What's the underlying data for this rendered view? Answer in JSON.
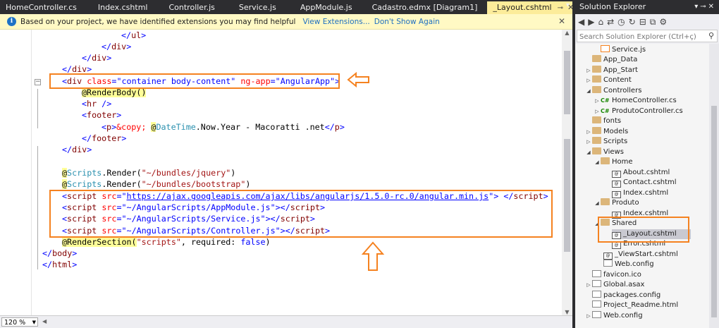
{
  "tabs": [
    {
      "label": "HomeController.cs",
      "active": false
    },
    {
      "label": "Index.cshtml",
      "active": false
    },
    {
      "label": "Controller.js",
      "active": false
    },
    {
      "label": "Service.js",
      "active": false
    },
    {
      "label": "AppModule.js",
      "active": false
    },
    {
      "label": "Cadastro.edmx [Diagram1]",
      "active": false
    },
    {
      "label": "_Layout.cshtml",
      "active": true
    }
  ],
  "infobar": {
    "message": "Based on your project, we have identified extensions you may find helpful",
    "view_extensions": "View Extensions...",
    "dont_show": "Don't Show Again"
  },
  "code": {
    "l1": "</ul>",
    "l2": "</div>",
    "l3": "</div>",
    "l4": "</div>",
    "l5_tag": "div",
    "l5_a1": "class",
    "l5_v1": "\"container body-content\"",
    "l5_a2": "ng-app",
    "l5_v2": "\"AngularApp\"",
    "l6": "@RenderBody()",
    "l7_tag": "hr",
    "l8_tag": "footer",
    "l9_ent": "&copy;",
    "l9_dt": "DateTime",
    "l9_rest": ".Now.Year - Macoratti .net",
    "l10": "</footer>",
    "l11": "</div>",
    "scripts_kw": "Scripts",
    "render": ".Render(",
    "bundle1": "\"~/bundles/jquery\"",
    "bundle2": "\"~/bundles/bootstrap\"",
    "src_attr": "src",
    "script_tag": "script",
    "src1": "https://ajax.googleapis.com/ajax/libs/angularjs/1.5.0-rc.0/angular.min.js",
    "src2": "\"~/AngularScripts/AppModule.js\"",
    "src3": "\"~/AngularScripts/Service.js\"",
    "src4": "\"~/AngularScripts/Controller.js\"",
    "render_section": "@RenderSection(",
    "scripts_str": "\"scripts\"",
    "required": ", required: ",
    "false_kw": "false",
    "body_close": "body",
    "html_close": "html"
  },
  "status": {
    "zoom": "120 %"
  },
  "solution_explorer": {
    "title": "Solution Explorer",
    "search_placeholder": "Search Solution Explorer (Ctrl+ç)",
    "items": [
      {
        "label": "Service.js",
        "kind": "js"
      },
      {
        "label": "App_Data",
        "kind": "folder"
      },
      {
        "label": "App_Start",
        "kind": "folder"
      },
      {
        "label": "Content",
        "kind": "folder"
      },
      {
        "label": "Controllers",
        "kind": "folder"
      },
      {
        "label": "HomeController.cs",
        "kind": "cs"
      },
      {
        "label": "ProdutoController.cs",
        "kind": "cs"
      },
      {
        "label": "fonts",
        "kind": "folder"
      },
      {
        "label": "Models",
        "kind": "folder"
      },
      {
        "label": "Scripts",
        "kind": "folder"
      },
      {
        "label": "Views",
        "kind": "folder"
      },
      {
        "label": "Home",
        "kind": "folder"
      },
      {
        "label": "About.cshtml",
        "kind": "cshtml"
      },
      {
        "label": "Contact.cshtml",
        "kind": "cshtml"
      },
      {
        "label": "Index.cshtml",
        "kind": "cshtml"
      },
      {
        "label": "Produto",
        "kind": "folder"
      },
      {
        "label": "Index.cshtml",
        "kind": "cshtml"
      },
      {
        "label": "Shared",
        "kind": "folder"
      },
      {
        "label": "_Layout.cshtml",
        "kind": "cshtml"
      },
      {
        "label": "Error.cshtml",
        "kind": "cshtml"
      },
      {
        "label": "_ViewStart.cshtml",
        "kind": "cshtml"
      },
      {
        "label": "Web.config",
        "kind": "config"
      },
      {
        "label": "favicon.ico",
        "kind": "file"
      },
      {
        "label": "Global.asax",
        "kind": "file"
      },
      {
        "label": "packages.config",
        "kind": "config"
      },
      {
        "label": "Project_Readme.html",
        "kind": "file"
      },
      {
        "label": "Web.config",
        "kind": "config"
      }
    ]
  },
  "colors": {
    "highlight": "#f58220",
    "tab_active": "#fcec9a",
    "infobar": "#fff9c4"
  }
}
